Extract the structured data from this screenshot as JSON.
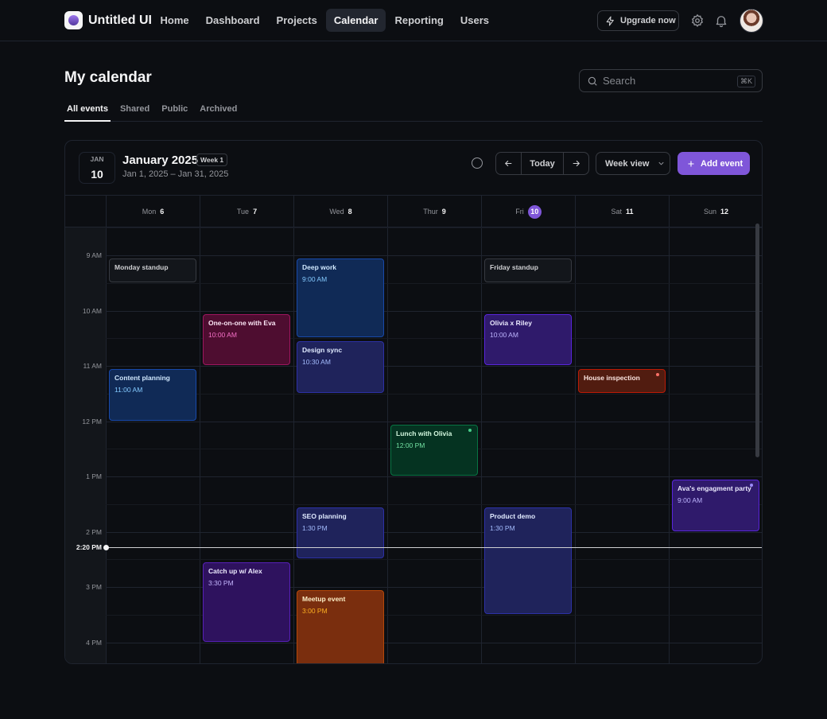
{
  "app": {
    "name": "Untitled UI"
  },
  "nav": {
    "links": [
      "Home",
      "Dashboard",
      "Projects",
      "Calendar",
      "Reporting",
      "Users"
    ],
    "active": "Calendar",
    "upgrade_label": "Upgrade now"
  },
  "page": {
    "title": "My calendar",
    "search_placeholder": "Search",
    "search_shortcut": "⌘K",
    "tabs": [
      "All events",
      "Shared",
      "Public",
      "Archived"
    ],
    "active_tab": "All events"
  },
  "calendar": {
    "badge_month": "JAN",
    "badge_day": "10",
    "title": "January 2025",
    "week_badge": "Week 1",
    "range": "Jan 1, 2025 – Jan 31, 2025",
    "today_label": "Today",
    "view_label": "Week view",
    "add_label": "Add event",
    "days": [
      {
        "name": "Mon",
        "num": "6"
      },
      {
        "name": "Tue",
        "num": "7"
      },
      {
        "name": "Wed",
        "num": "8"
      },
      {
        "name": "Thur",
        "num": "9"
      },
      {
        "name": "Fri",
        "num": "10"
      },
      {
        "name": "Sat",
        "num": "11"
      },
      {
        "name": "Sun",
        "num": "12"
      }
    ],
    "today_index": 4,
    "hours": [
      "9 AM",
      "10 AM",
      "11 AM",
      "12 PM",
      "1 PM",
      "2 PM",
      "3 PM",
      "4 PM"
    ],
    "now_label": "2:20 PM",
    "events": [
      {
        "day": 0,
        "start_hour": 9.0,
        "end_hour": 9.5,
        "title": "Monday standup",
        "time": "",
        "color": "gray"
      },
      {
        "day": 0,
        "start_hour": 11.0,
        "end_hour": 12.0,
        "title": "Content planning",
        "time": "11:00 AM",
        "color": "blue"
      },
      {
        "day": 1,
        "start_hour": 10.0,
        "end_hour": 11.0,
        "title": "One-on-one with Eva",
        "time": "10:00 AM",
        "color": "pink"
      },
      {
        "day": 1,
        "start_hour": 14.5,
        "end_hour": 16.0,
        "title": "Catch up w/ Alex",
        "time": "3:30 PM",
        "color": "violet"
      },
      {
        "day": 2,
        "start_hour": 9.0,
        "end_hour": 10.5,
        "title": "Deep work",
        "time": "9:00 AM",
        "color": "blue"
      },
      {
        "day": 2,
        "start_hour": 10.5,
        "end_hour": 11.5,
        "title": "Design sync",
        "time": "10:30 AM",
        "color": "indigo"
      },
      {
        "day": 2,
        "start_hour": 13.5,
        "end_hour": 14.5,
        "title": "SEO planning",
        "time": "1:30 PM",
        "color": "indigo"
      },
      {
        "day": 2,
        "start_hour": 15.0,
        "end_hour": 16.5,
        "title": "Meetup event",
        "time": "3:00 PM",
        "color": "orange"
      },
      {
        "day": 3,
        "start_hour": 12.0,
        "end_hour": 13.0,
        "title": "Lunch with Olivia",
        "time": "12:00 PM",
        "color": "green",
        "dot": "#47cd89"
      },
      {
        "day": 4,
        "start_hour": 9.0,
        "end_hour": 9.5,
        "title": "Friday standup",
        "time": "",
        "color": "gray"
      },
      {
        "day": 4,
        "start_hour": 10.0,
        "end_hour": 11.0,
        "title": "Olivia x Riley",
        "time": "10:00 AM",
        "color": "purple"
      },
      {
        "day": 4,
        "start_hour": 13.5,
        "end_hour": 15.5,
        "title": "Product demo",
        "time": "1:30 PM",
        "color": "indigo"
      },
      {
        "day": 5,
        "start_hour": 11.0,
        "end_hour": 11.5,
        "title": "House inspection",
        "time": "",
        "color": "red",
        "dot": "#f97066"
      },
      {
        "day": 6,
        "start_hour": 13.0,
        "end_hour": 14.0,
        "title": "Ava's engagment party",
        "time": "9:00 AM",
        "color": "purple",
        "dot": "#9b8afb"
      }
    ]
  },
  "colors": {
    "accent": "#7f56d9",
    "background": "#0c0e12",
    "border": "#1f242f"
  }
}
